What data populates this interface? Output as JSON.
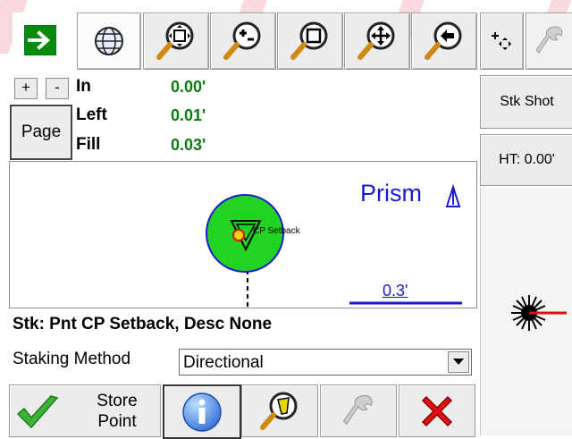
{
  "toolbar": {
    "icons": [
      "next-arrow-icon",
      "globe-icon",
      "zoom-extents-icon",
      "zoom-in-out-icon",
      "zoom-window-icon",
      "pan-icon",
      "zoom-previous-icon",
      "move-point-icon",
      "settings-wrench-icon"
    ]
  },
  "zoom": {
    "plus": "+",
    "minus": "-"
  },
  "page_button": "Page",
  "readouts": [
    {
      "label": "In",
      "value": "0.00'"
    },
    {
      "label": "Left",
      "value": "0.01'"
    },
    {
      "label": "Fill",
      "value": "0.03'"
    }
  ],
  "side": {
    "stake_shot": "Stk Shot",
    "ht": "HT: 0.00'"
  },
  "plot": {
    "target_label": "Prism",
    "point_label": "CP Setback",
    "scale_label": "0.3'"
  },
  "stake_info": "Stk: Pnt CP Setback, Desc None",
  "staking_method": {
    "label": "Staking Method",
    "value": "Directional"
  },
  "bottom": {
    "store_point_line1": "Store",
    "store_point_line2": "Point"
  },
  "colors": {
    "green_value": "#0e7a12",
    "target_green": "#22d422",
    "blue": "#1a1ad0",
    "red": "#e01010"
  }
}
